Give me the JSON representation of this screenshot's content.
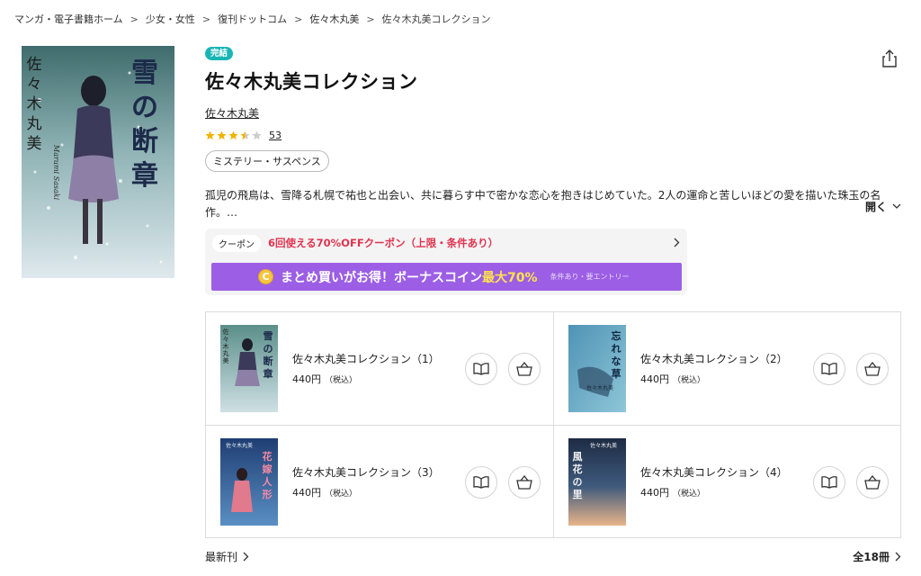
{
  "breadcrumb": [
    {
      "label": "マンガ・電子書籍ホーム"
    },
    {
      "label": "少女・女性"
    },
    {
      "label": "復刊ドットコム"
    },
    {
      "label": "佐々木丸美"
    },
    {
      "label": "佐々木丸美コレクション"
    }
  ],
  "breadcrumb_separator": ">",
  "main_cover": {
    "title_vertical": "雪の断章",
    "author_vertical": "佐々木丸美",
    "signature": "Marumi Sasaki",
    "colors": {
      "top": "#3f6c6c",
      "mid": "#8fb3b5",
      "bottom": "#dfe9ee"
    }
  },
  "product": {
    "badge": "完結",
    "title": "佐々木丸美コレクション",
    "author": "佐々木丸美",
    "rating_value": 3.5,
    "rating_max": 5,
    "rating_count": "53",
    "genre": "ミステリー・サスペンス",
    "description": "孤児の飛鳥は、雪降る札幌で祐也と出会い、共に暮らす中で密かな恋心を抱きはじめていた。2人の運命と苦しいほどの愛を描いた珠玉の名作。…",
    "expand_label": "開く"
  },
  "promo": {
    "coupon_label": "クーポン",
    "coupon_text": "6回使える70%OFFクーポン（上限・条件あり）",
    "coin_symbol": "C",
    "bonus_text": "まとめ買いがお得！ボーナスコイン",
    "bonus_highlight": "最大70%",
    "bonus_note": "条件あり・要エントリー"
  },
  "volumes": [
    {
      "title": "佐々木丸美コレクション（1）",
      "price": "440円",
      "tax": "（税込）",
      "cover_title": "雪の断章",
      "cover_author": "佐々木丸美",
      "cover_colors": [
        "#5b8f8a",
        "#cfe0e4"
      ]
    },
    {
      "title": "佐々木丸美コレクション（2）",
      "price": "440円",
      "tax": "（税込）",
      "cover_title": "忘れな草",
      "cover_author": "佐々木丸美",
      "cover_colors": [
        "#4f93b5",
        "#8ec6d8"
      ]
    },
    {
      "title": "佐々木丸美コレクション（3）",
      "price": "440円",
      "tax": "（税込）",
      "cover_title": "花嫁人形",
      "cover_author": "佐々木丸美",
      "cover_colors": [
        "#1f3e73",
        "#5a8fc4"
      ]
    },
    {
      "title": "佐々木丸美コレクション（4）",
      "price": "440円",
      "tax": "（税込）",
      "cover_title": "風花の里",
      "cover_author": "佐々木丸美",
      "cover_colors": [
        "#1e2b44",
        "#e8b48a"
      ]
    }
  ],
  "footer": {
    "latest_label": "最新刊",
    "all_count_label": "全18冊"
  },
  "colors": {
    "badge": "#19b5b5",
    "coupon_red": "#e0334e",
    "bonus_purple": "#9c5ee5",
    "bonus_yellow": "#ffe24d",
    "star_filled": "#f2b400",
    "star_empty": "#cccccc"
  }
}
